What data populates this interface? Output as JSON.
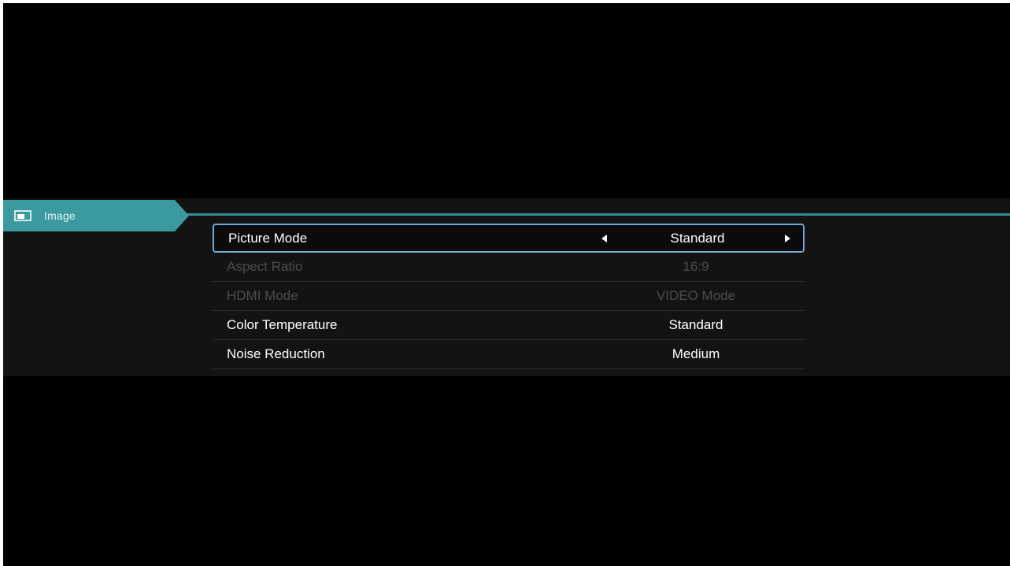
{
  "category": {
    "icon": "picture-icon",
    "label": "Image",
    "accent_color": "#3b9aa0"
  },
  "settings": [
    {
      "label": "Picture Mode",
      "value": "Standard",
      "state": "selected"
    },
    {
      "label": "Aspect Ratio",
      "value": "16:9",
      "state": "disabled"
    },
    {
      "label": "HDMI Mode",
      "value": "VIDEO Mode",
      "state": "disabled"
    },
    {
      "label": "Color Temperature",
      "value": "Standard",
      "state": "enabled"
    },
    {
      "label": "Noise Reduction",
      "value": "Medium",
      "state": "enabled"
    }
  ],
  "colors": {
    "background": "#000000",
    "panel": "#131313",
    "selection_border": "#6fa8d6",
    "disabled_text": "#4c4c4c"
  }
}
